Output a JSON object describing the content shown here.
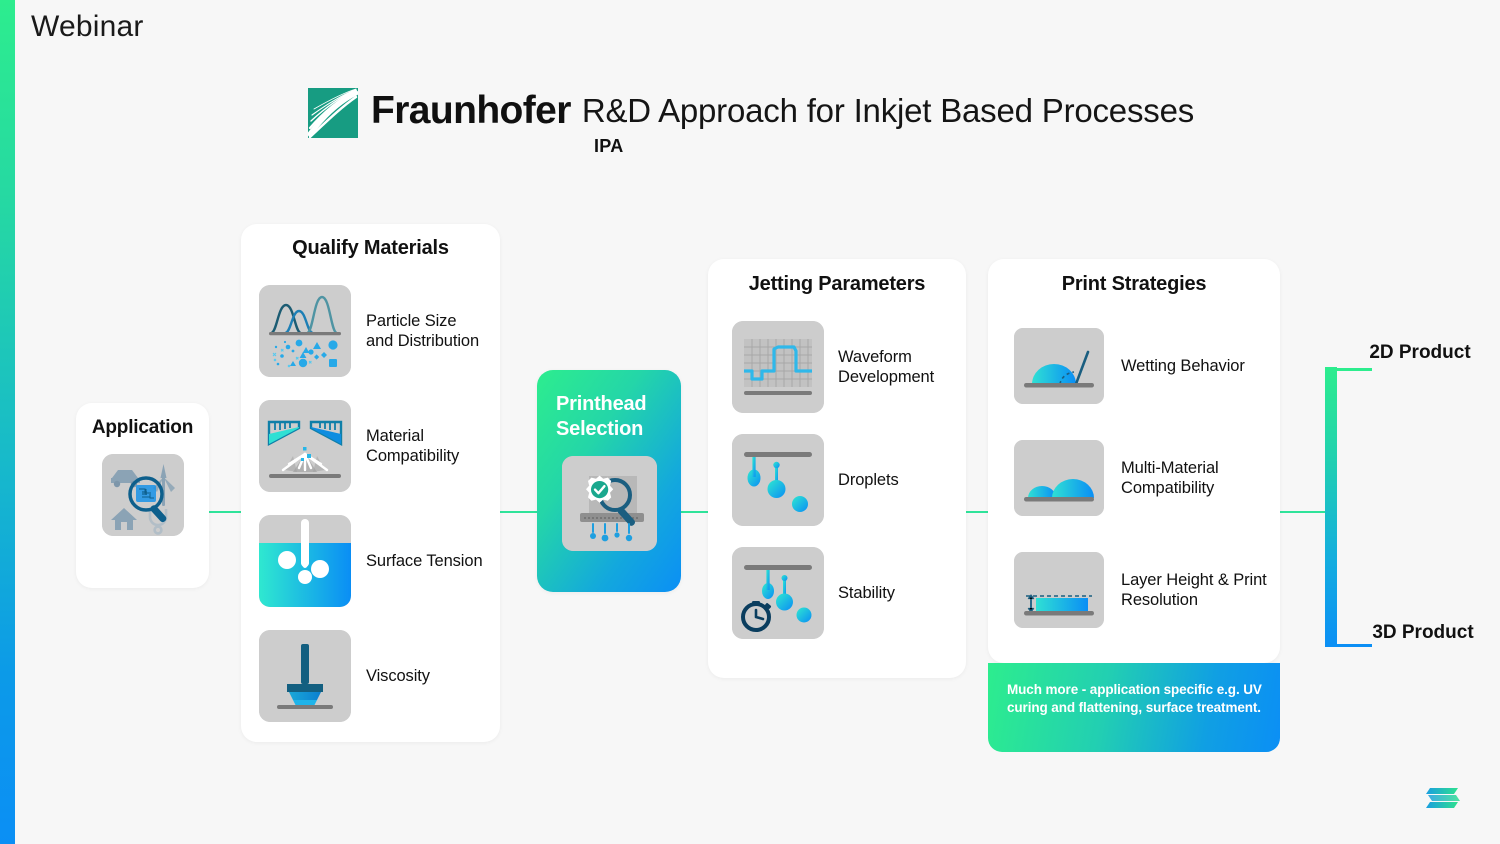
{
  "page": {
    "title": "Webinar",
    "background": "#f7f7f7",
    "accent_green": "#2ded8e",
    "accent_blue": "#0b8ff5",
    "connector_color": "#2fe39a"
  },
  "header": {
    "logo_name": "fraunhofer-logo",
    "brand": "Fraunhofer",
    "institute": "IPA",
    "subtitle": "R&D Approach for Inkjet Based Processes"
  },
  "application": {
    "title": "Application",
    "icon": "application-domains-icon"
  },
  "qualify": {
    "title": "Qualify Materials",
    "items": [
      {
        "label": "Particle Size and Distribution",
        "icon": "particle-distribution-icon"
      },
      {
        "label": "Material Compatibility",
        "icon": "material-compatibility-icon"
      },
      {
        "label": "Surface Tension",
        "icon": "surface-tension-icon"
      },
      {
        "label": "Viscosity",
        "icon": "viscosity-icon"
      }
    ]
  },
  "printhead": {
    "title": "Printhead Selection",
    "icon": "printhead-selection-icon"
  },
  "jetting": {
    "title": "Jetting Parameters",
    "items": [
      {
        "label": "Waveform Development",
        "icon": "waveform-icon"
      },
      {
        "label": "Droplets",
        "icon": "droplets-icon"
      },
      {
        "label": "Stability",
        "icon": "stability-stopwatch-icon"
      }
    ]
  },
  "print_strategies": {
    "title": "Print Strategies",
    "items": [
      {
        "label": "Wetting Behavior",
        "icon": "contact-angle-icon"
      },
      {
        "label": "Multi-Material Compatibility",
        "icon": "two-droplets-icon"
      },
      {
        "label": "Layer Height & Print Resolution",
        "icon": "layer-height-icon"
      }
    ],
    "banner": "Much more - application specific e.g. UV curing and flattening, surface treatment."
  },
  "outputs": {
    "top": "2D Product",
    "bottom": "3D Product"
  },
  "footer": {
    "logo_name": "stacked-layers-logo"
  }
}
